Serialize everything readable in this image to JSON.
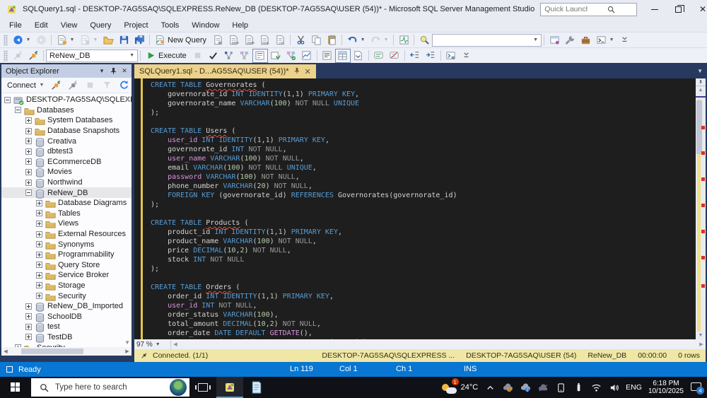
{
  "window": {
    "title": "SQLQuery1.sql - DESKTOP-7AG5SAQ\\SQLEXPRESS.ReNew_DB (DESKTOP-7AG5SAQ\\USER (54))* - Microsoft SQL Server Management Studio",
    "quick_launch_placeholder": "Quick Launch (Ctrl+Q)"
  },
  "menu": {
    "items": [
      "File",
      "Edit",
      "View",
      "Query",
      "Project",
      "Tools",
      "Window",
      "Help"
    ]
  },
  "toolbar_standard": {
    "items": [
      {
        "type": "grip"
      },
      {
        "type": "btn",
        "icon": "nav-back",
        "name": "navigate-backward",
        "dd": true
      },
      {
        "type": "btn",
        "icon": "nav-forward",
        "name": "navigate-forward",
        "disabled": true
      },
      {
        "type": "sep"
      },
      {
        "type": "btn",
        "icon": "doc-new",
        "name": "new-item",
        "dd": true
      },
      {
        "type": "btn",
        "icon": "doc-add",
        "name": "add-item",
        "disabled": true,
        "dd": true
      },
      {
        "type": "btn",
        "icon": "folder-open",
        "name": "open-file"
      },
      {
        "type": "btn",
        "icon": "save",
        "name": "save"
      },
      {
        "type": "btn",
        "icon": "save-all",
        "name": "save-all"
      },
      {
        "type": "sep"
      },
      {
        "type": "btn",
        "icon": "new-query",
        "name": "new-query",
        "label": "New Query"
      },
      {
        "type": "btn",
        "icon": "doc-dbengine",
        "name": "database-engine-query"
      },
      {
        "type": "btn",
        "icon": "doc-mdx",
        "name": "analysis-services-mdx-query"
      },
      {
        "type": "btn",
        "icon": "doc-dmx",
        "name": "analysis-services-dmx-query"
      },
      {
        "type": "btn",
        "icon": "doc-xmla",
        "name": "analysis-services-xmla-query"
      },
      {
        "type": "btn",
        "icon": "doc-as",
        "name": "as-query"
      },
      {
        "type": "sep"
      },
      {
        "type": "btn",
        "icon": "cut",
        "name": "cut"
      },
      {
        "type": "btn",
        "icon": "copy",
        "name": "copy"
      },
      {
        "type": "btn",
        "icon": "paste",
        "name": "paste"
      },
      {
        "type": "sep"
      },
      {
        "type": "btn",
        "icon": "undo",
        "name": "undo",
        "dd": true
      },
      {
        "type": "btn",
        "icon": "redo",
        "name": "redo",
        "disabled": true,
        "dd": true
      },
      {
        "type": "sep"
      },
      {
        "type": "btn",
        "icon": "activity",
        "name": "activity-monitor"
      },
      {
        "type": "sep"
      },
      {
        "type": "btn",
        "icon": "find",
        "name": "find"
      },
      {
        "type": "combo",
        "name": "find-combo",
        "value": "",
        "width": 155,
        "dd": true
      },
      {
        "type": "sep"
      },
      {
        "type": "btn",
        "icon": "winstar",
        "name": "registered-servers"
      },
      {
        "type": "btn",
        "icon": "wrench",
        "name": "properties-window"
      },
      {
        "type": "btn",
        "icon": "toolbox",
        "name": "template-explorer"
      },
      {
        "type": "btn",
        "icon": "cmdwin",
        "name": "command-window",
        "dd": true
      },
      {
        "type": "btn",
        "icon": "overflow",
        "name": "toolbar-options"
      }
    ]
  },
  "toolbar_sql": {
    "database_selector": "ReNew_DB",
    "items": [
      {
        "type": "grip"
      },
      {
        "type": "btn",
        "icon": "plug-gray",
        "name": "connect",
        "disabled": true
      },
      {
        "type": "btn",
        "icon": "plug",
        "name": "change-connection"
      },
      {
        "type": "sep"
      },
      {
        "type": "dbcombo",
        "name": "available-databases",
        "width": 130
      },
      {
        "type": "sep"
      },
      {
        "type": "btn",
        "icon": "play",
        "name": "execute",
        "label": "Execute"
      },
      {
        "type": "btn",
        "icon": "stop",
        "name": "cancel-executing-query",
        "disabled": true
      },
      {
        "type": "btn",
        "icon": "check",
        "name": "parse"
      },
      {
        "type": "btn",
        "icon": "dta",
        "name": "analyze-query-in-dta"
      },
      {
        "type": "btn",
        "icon": "estplan",
        "name": "display-estimated-plan"
      },
      {
        "type": "btn",
        "icon": "qoptions",
        "name": "query-options",
        "boxed": true
      },
      {
        "type": "btn",
        "icon": "intellisense",
        "name": "intellisense-enabled"
      },
      {
        "type": "btn",
        "icon": "actualplan",
        "name": "include-actual-plan"
      },
      {
        "type": "btn",
        "icon": "livestats",
        "name": "live-query-statistics"
      },
      {
        "type": "sep"
      },
      {
        "type": "btn",
        "icon": "res-text",
        "name": "results-to-text"
      },
      {
        "type": "btn",
        "icon": "res-grid",
        "name": "results-to-grid",
        "boxed": true
      },
      {
        "type": "btn",
        "icon": "res-file",
        "name": "results-to-file"
      },
      {
        "type": "sep"
      },
      {
        "type": "btn",
        "icon": "comment",
        "name": "comment-selection"
      },
      {
        "type": "btn",
        "icon": "uncomment",
        "name": "uncomment-selection"
      },
      {
        "type": "sep"
      },
      {
        "type": "btn",
        "icon": "indent-dec",
        "name": "decrease-indent"
      },
      {
        "type": "btn",
        "icon": "indent-inc",
        "name": "increase-indent"
      },
      {
        "type": "sep"
      },
      {
        "type": "btn",
        "icon": "sqlcmd",
        "name": "sqlcmd-mode"
      },
      {
        "type": "btn",
        "icon": "overflow",
        "name": "toolbar-options"
      }
    ]
  },
  "object_explorer": {
    "title": "Object Explorer",
    "connect_label": "Connect",
    "tree": [
      {
        "label": "DESKTOP-7AG5SAQ\\SQLEXPRESS",
        "level": 0,
        "expand": "minus",
        "icon": "server"
      },
      {
        "label": "Databases",
        "level": 1,
        "expand": "minus",
        "icon": "folder"
      },
      {
        "label": "System Databases",
        "level": 2,
        "expand": "plus",
        "icon": "folder"
      },
      {
        "label": "Database Snapshots",
        "level": 2,
        "expand": "plus",
        "icon": "folder"
      },
      {
        "label": "Creativa",
        "level": 2,
        "expand": "plus",
        "icon": "db"
      },
      {
        "label": "dbtest3",
        "level": 2,
        "expand": "plus",
        "icon": "db"
      },
      {
        "label": "ECommerceDB",
        "level": 2,
        "expand": "plus",
        "icon": "db"
      },
      {
        "label": "Movies",
        "level": 2,
        "expand": "plus",
        "icon": "db"
      },
      {
        "label": "Northwind",
        "level": 2,
        "expand": "plus",
        "icon": "db"
      },
      {
        "label": "ReNew_DB",
        "level": 2,
        "expand": "minus",
        "icon": "db",
        "selected": true
      },
      {
        "label": "Database Diagrams",
        "level": 3,
        "expand": "plus",
        "icon": "folder"
      },
      {
        "label": "Tables",
        "level": 3,
        "expand": "plus",
        "icon": "folder"
      },
      {
        "label": "Views",
        "level": 3,
        "expand": "plus",
        "icon": "folder"
      },
      {
        "label": "External Resources",
        "level": 3,
        "expand": "plus",
        "icon": "folder"
      },
      {
        "label": "Synonyms",
        "level": 3,
        "expand": "plus",
        "icon": "folder"
      },
      {
        "label": "Programmability",
        "level": 3,
        "expand": "plus",
        "icon": "folder"
      },
      {
        "label": "Query Store",
        "level": 3,
        "expand": "plus",
        "icon": "folder"
      },
      {
        "label": "Service Broker",
        "level": 3,
        "expand": "plus",
        "icon": "folder"
      },
      {
        "label": "Storage",
        "level": 3,
        "expand": "plus",
        "icon": "folder"
      },
      {
        "label": "Security",
        "level": 3,
        "expand": "plus",
        "icon": "folder"
      },
      {
        "label": "ReNew_DB_Imported",
        "level": 2,
        "expand": "plus",
        "icon": "db"
      },
      {
        "label": "SchoolDB",
        "level": 2,
        "expand": "plus",
        "icon": "db"
      },
      {
        "label": "test",
        "level": 2,
        "expand": "plus",
        "icon": "db"
      },
      {
        "label": "TestDB",
        "level": 2,
        "expand": "plus",
        "icon": "db"
      },
      {
        "label": "Security",
        "level": 1,
        "expand": "plus",
        "icon": "folder"
      }
    ]
  },
  "editor": {
    "tab_title": "SQLQuery1.sql - D...AG5SAQ\\USER (54))*",
    "zoom_level": "97 %",
    "scroll_marks": [
      0.13,
      0.24,
      0.35,
      0.46,
      0.57,
      0.68,
      0.8
    ],
    "code_lines": [
      [
        [
          "CREATE TABLE ",
          "kw"
        ],
        [
          "Governorates",
          "err"
        ],
        [
          " (",
          "df"
        ]
      ],
      [
        [
          "    governorate_id ",
          "df"
        ],
        [
          "INT IDENTITY",
          "kw"
        ],
        [
          "(",
          "df"
        ],
        [
          "1",
          "num"
        ],
        [
          ",",
          "df"
        ],
        [
          "1",
          "num"
        ],
        [
          ") ",
          "df"
        ],
        [
          "PRIMARY KEY",
          "kw"
        ],
        [
          ",",
          "df"
        ]
      ],
      [
        [
          "    governorate_name ",
          "df"
        ],
        [
          "VARCHAR",
          "kw"
        ],
        [
          "(",
          "df"
        ],
        [
          "100",
          "num"
        ],
        [
          ") ",
          "df"
        ],
        [
          "NOT NULL ",
          "gr"
        ],
        [
          "UNIQUE",
          "kw"
        ]
      ],
      [
        [
          ");",
          "df"
        ]
      ],
      [],
      [
        [
          "CREATE TABLE ",
          "kw"
        ],
        [
          "Users",
          "err"
        ],
        [
          " (",
          "df"
        ]
      ],
      [
        [
          "    ",
          "df"
        ],
        [
          "user_id",
          "fn"
        ],
        [
          " ",
          "df"
        ],
        [
          "INT IDENTITY",
          "kw"
        ],
        [
          "(",
          "df"
        ],
        [
          "1",
          "num"
        ],
        [
          ",",
          "df"
        ],
        [
          "1",
          "num"
        ],
        [
          ") ",
          "df"
        ],
        [
          "PRIMARY KEY",
          "kw"
        ],
        [
          ",",
          "df"
        ]
      ],
      [
        [
          "    governorate_id ",
          "df"
        ],
        [
          "INT ",
          "kw"
        ],
        [
          "NOT NULL",
          "gr"
        ],
        [
          ",",
          "df"
        ]
      ],
      [
        [
          "    ",
          "df"
        ],
        [
          "user_name",
          "fn"
        ],
        [
          " ",
          "df"
        ],
        [
          "VARCHAR",
          "kw"
        ],
        [
          "(",
          "df"
        ],
        [
          "100",
          "num"
        ],
        [
          ") ",
          "df"
        ],
        [
          "NOT NULL",
          "gr"
        ],
        [
          ",",
          "df"
        ]
      ],
      [
        [
          "    email ",
          "df"
        ],
        [
          "VARCHAR",
          "kw"
        ],
        [
          "(",
          "df"
        ],
        [
          "100",
          "num"
        ],
        [
          ") ",
          "df"
        ],
        [
          "NOT NULL ",
          "gr"
        ],
        [
          "UNIQUE",
          "kw"
        ],
        [
          ",",
          "df"
        ]
      ],
      [
        [
          "    ",
          "df"
        ],
        [
          "password",
          "fn"
        ],
        [
          " ",
          "df"
        ],
        [
          "VARCHAR",
          "kw"
        ],
        [
          "(",
          "df"
        ],
        [
          "100",
          "num"
        ],
        [
          ") ",
          "df"
        ],
        [
          "NOT NULL",
          "gr"
        ],
        [
          ",",
          "df"
        ]
      ],
      [
        [
          "    phone_number ",
          "df"
        ],
        [
          "VARCHAR",
          "kw"
        ],
        [
          "(",
          "df"
        ],
        [
          "20",
          "num"
        ],
        [
          ") ",
          "df"
        ],
        [
          "NOT NULL",
          "gr"
        ],
        [
          ",",
          "df"
        ]
      ],
      [
        [
          "    ",
          "df"
        ],
        [
          "FOREIGN KEY",
          "kw"
        ],
        [
          " (governorate_id) ",
          "df"
        ],
        [
          "REFERENCES",
          "kw"
        ],
        [
          " Governorates(governorate_id)",
          "df"
        ]
      ],
      [
        [
          ");",
          "df"
        ]
      ],
      [],
      [
        [
          "CREATE TABLE ",
          "kw"
        ],
        [
          "Products",
          "err"
        ],
        [
          " (",
          "df"
        ]
      ],
      [
        [
          "    product_id ",
          "df"
        ],
        [
          "INT IDENTITY",
          "kw"
        ],
        [
          "(",
          "df"
        ],
        [
          "1",
          "num"
        ],
        [
          ",",
          "df"
        ],
        [
          "1",
          "num"
        ],
        [
          ") ",
          "df"
        ],
        [
          "PRIMARY KEY",
          "kw"
        ],
        [
          ",",
          "df"
        ]
      ],
      [
        [
          "    product_name ",
          "df"
        ],
        [
          "VARCHAR",
          "kw"
        ],
        [
          "(",
          "df"
        ],
        [
          "100",
          "num"
        ],
        [
          ") ",
          "df"
        ],
        [
          "NOT NULL",
          "gr"
        ],
        [
          ",",
          "df"
        ]
      ],
      [
        [
          "    price ",
          "df"
        ],
        [
          "DECIMAL",
          "kw"
        ],
        [
          "(",
          "df"
        ],
        [
          "10",
          "num"
        ],
        [
          ",",
          "df"
        ],
        [
          "2",
          "num"
        ],
        [
          ") ",
          "df"
        ],
        [
          "NOT NULL",
          "gr"
        ],
        [
          ",",
          "df"
        ]
      ],
      [
        [
          "    stock ",
          "df"
        ],
        [
          "INT ",
          "kw"
        ],
        [
          "NOT NULL",
          "gr"
        ]
      ],
      [
        [
          ");",
          "df"
        ]
      ],
      [],
      [
        [
          "CREATE TABLE ",
          "kw"
        ],
        [
          "Orders",
          "err"
        ],
        [
          " (",
          "df"
        ]
      ],
      [
        [
          "    order_id ",
          "df"
        ],
        [
          "INT IDENTITY",
          "kw"
        ],
        [
          "(",
          "df"
        ],
        [
          "1",
          "num"
        ],
        [
          ",",
          "df"
        ],
        [
          "1",
          "num"
        ],
        [
          ") ",
          "df"
        ],
        [
          "PRIMARY KEY",
          "kw"
        ],
        [
          ",",
          "df"
        ]
      ],
      [
        [
          "    ",
          "df"
        ],
        [
          "user_id",
          "fn"
        ],
        [
          " ",
          "df"
        ],
        [
          "INT ",
          "kw"
        ],
        [
          "NOT NULL",
          "gr"
        ],
        [
          ",",
          "df"
        ]
      ],
      [
        [
          "    order_status ",
          "df"
        ],
        [
          "VARCHAR",
          "kw"
        ],
        [
          "(",
          "df"
        ],
        [
          "100",
          "num"
        ],
        [
          "),",
          "df"
        ]
      ],
      [
        [
          "    total_amount ",
          "df"
        ],
        [
          "DECIMAL",
          "kw"
        ],
        [
          "(",
          "df"
        ],
        [
          "10",
          "num"
        ],
        [
          ",",
          "df"
        ],
        [
          "2",
          "num"
        ],
        [
          ") ",
          "df"
        ],
        [
          "NOT NULL",
          "gr"
        ],
        [
          ",",
          "df"
        ]
      ],
      [
        [
          "    order_date ",
          "df"
        ],
        [
          "DATE DEFAULT ",
          "kw"
        ],
        [
          "GETDATE",
          "fn"
        ],
        [
          "(),",
          "df"
        ]
      ],
      [
        [
          "    ",
          "df"
        ],
        [
          "FOREIGN KEY",
          "kw"
        ],
        [
          " (",
          "df"
        ],
        [
          "user_id",
          "fn"
        ],
        [
          ") ",
          "df"
        ],
        [
          "REFERENCES",
          "kw"
        ],
        [
          " Users(",
          "df"
        ],
        [
          "user_id",
          "fn"
        ],
        [
          ")",
          "df"
        ]
      ]
    ],
    "colors": {
      "keyword": "#569CD6",
      "system_function": "#D993E0",
      "number": "#B5CEA8",
      "operator_gray": "#9A9A9A",
      "default": "#D4D4D4",
      "background": "#1E1E1E"
    }
  },
  "connected_bar": {
    "status": "Connected. (1/1)",
    "server": "DESKTOP-7AG5SAQ\\SQLEXPRESS ...",
    "user": "DESKTOP-7AG5SAQ\\USER (54)",
    "database": "ReNew_DB",
    "time": "00:00:00",
    "rows": "0 rows"
  },
  "status_bar": {
    "state": "Ready",
    "line": "Ln 119",
    "col": "Col 1",
    "ch": "Ch 1",
    "mode": "INS"
  },
  "taskbar": {
    "search_placeholder": "Type here to search",
    "temperature": "24°C",
    "notification_badge": "1",
    "tray_icons": [
      "chevron-up",
      "onedrive-personal",
      "onedrive-cloud",
      "cloud-offline",
      "phone-link",
      "usb-device",
      "wifi",
      "volume"
    ],
    "language": "ENG",
    "time": "6:18 PM",
    "date": "10/10/2025",
    "notification_count": "4"
  }
}
